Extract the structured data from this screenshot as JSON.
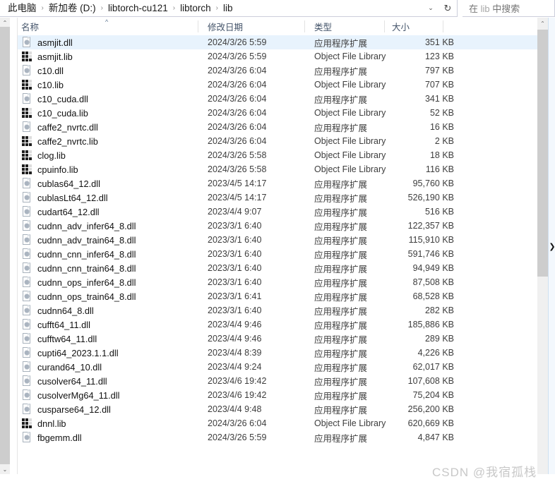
{
  "addressbar": {
    "breadcrumbs": [
      "此电脑",
      "新加卷 (D:)",
      "libtorch-cu121",
      "libtorch",
      "lib"
    ],
    "separator": "›",
    "dropdown_icon": "chevron-down-icon",
    "refresh_icon": "refresh-icon",
    "refresh_glyph": "↻",
    "caret_glyph": "⌄"
  },
  "search": {
    "placeholder_prefix": "在 ",
    "placeholder_target": "lib",
    "placeholder_suffix": " 中搜索"
  },
  "columns": {
    "name": "名称",
    "date": "修改日期",
    "type": "类型",
    "size": "大小",
    "sort_indicator": "^"
  },
  "types": {
    "dll": "应用程序扩展",
    "lib": "Object File Library"
  },
  "files": [
    {
      "name": "asmjit.dll",
      "date": "2024/3/26 5:59",
      "type": "应用程序扩展",
      "size": "351 KB",
      "icon": "dll",
      "selected": true
    },
    {
      "name": "asmjit.lib",
      "date": "2024/3/26 5:59",
      "type": "Object File Library",
      "size": "123 KB",
      "icon": "lib",
      "selected": false
    },
    {
      "name": "c10.dll",
      "date": "2024/3/26 6:04",
      "type": "应用程序扩展",
      "size": "797 KB",
      "icon": "dll",
      "selected": false
    },
    {
      "name": "c10.lib",
      "date": "2024/3/26 6:04",
      "type": "Object File Library",
      "size": "707 KB",
      "icon": "lib",
      "selected": false
    },
    {
      "name": "c10_cuda.dll",
      "date": "2024/3/26 6:04",
      "type": "应用程序扩展",
      "size": "341 KB",
      "icon": "dll",
      "selected": false
    },
    {
      "name": "c10_cuda.lib",
      "date": "2024/3/26 6:04",
      "type": "Object File Library",
      "size": "52 KB",
      "icon": "lib",
      "selected": false
    },
    {
      "name": "caffe2_nvrtc.dll",
      "date": "2024/3/26 6:04",
      "type": "应用程序扩展",
      "size": "16 KB",
      "icon": "dll",
      "selected": false
    },
    {
      "name": "caffe2_nvrtc.lib",
      "date": "2024/3/26 6:04",
      "type": "Object File Library",
      "size": "2 KB",
      "icon": "lib",
      "selected": false
    },
    {
      "name": "clog.lib",
      "date": "2024/3/26 5:58",
      "type": "Object File Library",
      "size": "18 KB",
      "icon": "lib",
      "selected": false
    },
    {
      "name": "cpuinfo.lib",
      "date": "2024/3/26 5:58",
      "type": "Object File Library",
      "size": "116 KB",
      "icon": "lib",
      "selected": false
    },
    {
      "name": "cublas64_12.dll",
      "date": "2023/4/5 14:17",
      "type": "应用程序扩展",
      "size": "95,760 KB",
      "icon": "dll",
      "selected": false
    },
    {
      "name": "cublasLt64_12.dll",
      "date": "2023/4/5 14:17",
      "type": "应用程序扩展",
      "size": "526,190 KB",
      "icon": "dll",
      "selected": false
    },
    {
      "name": "cudart64_12.dll",
      "date": "2023/4/4 9:07",
      "type": "应用程序扩展",
      "size": "516 KB",
      "icon": "dll",
      "selected": false
    },
    {
      "name": "cudnn_adv_infer64_8.dll",
      "date": "2023/3/1 6:40",
      "type": "应用程序扩展",
      "size": "122,357 KB",
      "icon": "dll",
      "selected": false
    },
    {
      "name": "cudnn_adv_train64_8.dll",
      "date": "2023/3/1 6:40",
      "type": "应用程序扩展",
      "size": "115,910 KB",
      "icon": "dll",
      "selected": false
    },
    {
      "name": "cudnn_cnn_infer64_8.dll",
      "date": "2023/3/1 6:40",
      "type": "应用程序扩展",
      "size": "591,746 KB",
      "icon": "dll",
      "selected": false
    },
    {
      "name": "cudnn_cnn_train64_8.dll",
      "date": "2023/3/1 6:40",
      "type": "应用程序扩展",
      "size": "94,949 KB",
      "icon": "dll",
      "selected": false
    },
    {
      "name": "cudnn_ops_infer64_8.dll",
      "date": "2023/3/1 6:40",
      "type": "应用程序扩展",
      "size": "87,508 KB",
      "icon": "dll",
      "selected": false
    },
    {
      "name": "cudnn_ops_train64_8.dll",
      "date": "2023/3/1 6:41",
      "type": "应用程序扩展",
      "size": "68,528 KB",
      "icon": "dll",
      "selected": false
    },
    {
      "name": "cudnn64_8.dll",
      "date": "2023/3/1 6:40",
      "type": "应用程序扩展",
      "size": "282 KB",
      "icon": "dll",
      "selected": false
    },
    {
      "name": "cufft64_11.dll",
      "date": "2023/4/4 9:46",
      "type": "应用程序扩展",
      "size": "185,886 KB",
      "icon": "dll",
      "selected": false
    },
    {
      "name": "cufftw64_11.dll",
      "date": "2023/4/4 9:46",
      "type": "应用程序扩展",
      "size": "289 KB",
      "icon": "dll",
      "selected": false
    },
    {
      "name": "cupti64_2023.1.1.dll",
      "date": "2023/4/4 8:39",
      "type": "应用程序扩展",
      "size": "4,226 KB",
      "icon": "dll",
      "selected": false
    },
    {
      "name": "curand64_10.dll",
      "date": "2023/4/4 9:24",
      "type": "应用程序扩展",
      "size": "62,017 KB",
      "icon": "dll",
      "selected": false
    },
    {
      "name": "cusolver64_11.dll",
      "date": "2023/4/6 19:42",
      "type": "应用程序扩展",
      "size": "107,608 KB",
      "icon": "dll",
      "selected": false
    },
    {
      "name": "cusolverMg64_11.dll",
      "date": "2023/4/6 19:42",
      "type": "应用程序扩展",
      "size": "75,204 KB",
      "icon": "dll",
      "selected": false
    },
    {
      "name": "cusparse64_12.dll",
      "date": "2023/4/4 9:48",
      "type": "应用程序扩展",
      "size": "256,200 KB",
      "icon": "dll",
      "selected": false
    },
    {
      "name": "dnnl.lib",
      "date": "2024/3/26 6:04",
      "type": "Object File Library",
      "size": "620,669 KB",
      "icon": "lib",
      "selected": false
    },
    {
      "name": "fbgemm.dll",
      "date": "2024/3/26 5:59",
      "type": "应用程序扩展",
      "size": "4,847 KB",
      "icon": "dll",
      "selected": false
    }
  ],
  "scrollbar": {
    "up_glyph": "⌃",
    "down_glyph": "⌄"
  },
  "rightpanel": {
    "expand_glyph": "❯"
  },
  "watermark": {
    "text": "CSDN @我宿孤栈"
  }
}
